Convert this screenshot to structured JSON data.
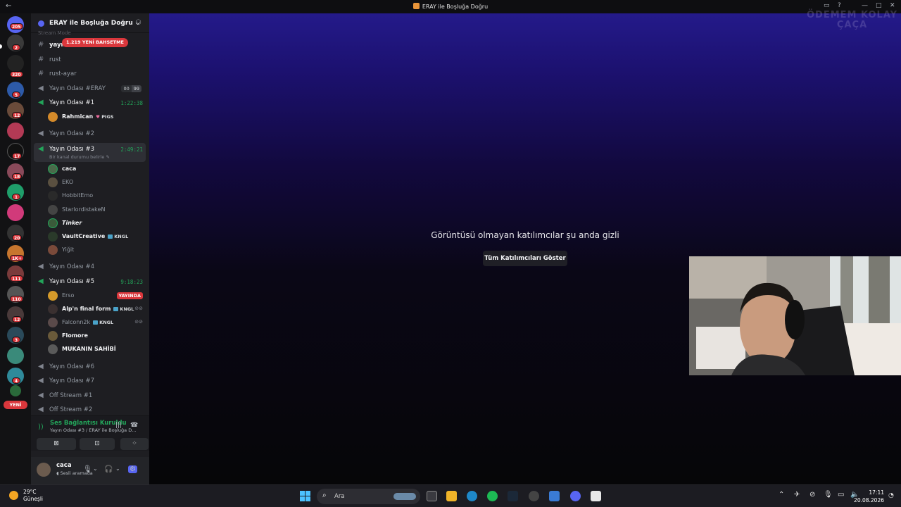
{
  "window": {
    "title": "ERAY ile Boşluğa Doğru"
  },
  "rail": {
    "badges": [
      "205",
      "2",
      "320",
      "5",
      "12",
      "17",
      "18",
      "1",
      "20",
      "1K+",
      "111",
      "110",
      "12",
      "3",
      "4"
    ],
    "new_label": "YENİ"
  },
  "guild": {
    "name": "ERAY ile Boşluğa Doğru",
    "faded_label": "Stream Mode",
    "mention_label": "1.219 YENİ BAHSETME"
  },
  "channels": {
    "yayin": "yayın",
    "rust": "rust",
    "rust_ayar": "rust-ayar",
    "eray": {
      "label": "Yayın Odası #ERAY",
      "count_a": "00",
      "count_b": "99"
    },
    "oda1": {
      "label": "Yayın Odası #1",
      "time": "1:22:38"
    },
    "oda2": "Yayın Odası #2",
    "oda3": {
      "label": "Yayın Odası #3",
      "time": "2:49:21",
      "sub": "Bir kanal durumu belirle"
    },
    "oda4": "Yayın Odası #4",
    "oda5": {
      "label": "Yayın Odası #5",
      "time": "9:18:23"
    },
    "oda6": "Yayın Odası #6",
    "oda7": "Yayın Odası #7",
    "off1": "Off Stream #1",
    "off2": "Off Stream #2"
  },
  "users": {
    "rahmican": {
      "name": "Rahmican",
      "tag": "PIGS"
    },
    "caca": "caca",
    "eko": "EKO",
    "hobbit": "HobbitEmo",
    "starlord": "StarlordistakeN",
    "tinker": "Tinker",
    "vault": {
      "name": "VaultCreative",
      "tag": "KNGL"
    },
    "yigit": "Yiğit",
    "erso": {
      "name": "Erso",
      "live": "YAYINDA"
    },
    "alp": {
      "name": "Alp'n final form",
      "tag": "KNGL"
    },
    "falconn": {
      "name": "Falconn2k",
      "tag": "KNGL"
    },
    "flomore": "Flomore",
    "mukanin": "MUKANIN SAHİBİ"
  },
  "voice": {
    "status": "Ses Bağlantısı Kuruldu",
    "detail": "Yayın Odası #3 / ERAY ile Boşluğa D..."
  },
  "account": {
    "name": "caca",
    "status": "Sesli aramada"
  },
  "main": {
    "hidden_message": "Görüntüsü olmayan katılımcılar şu anda gizli",
    "show_button": "Tüm Katılımcıları Göster",
    "watermark_line1": "ÖDEMEM KOLAY",
    "watermark_line2": "ÇAÇA"
  },
  "taskbar": {
    "temp": "29°C",
    "weather": "Güneşli",
    "search": "Ara",
    "time": "17:11",
    "date": "20.08.2026"
  },
  "colors": {
    "accent": "#5865f2",
    "online": "#23a55a",
    "danger": "#da373c"
  }
}
